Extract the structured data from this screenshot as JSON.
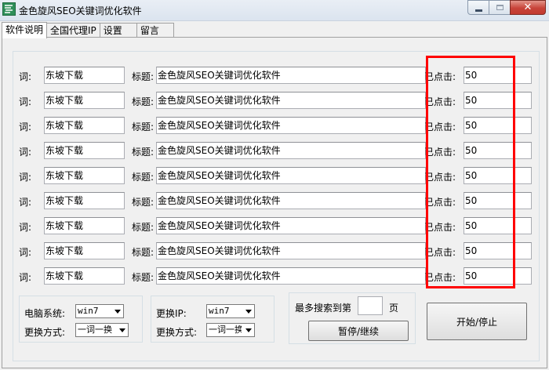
{
  "window": {
    "title": "金色旋风SEO关键词优化软件"
  },
  "tabs": [
    {
      "label": "软件说明"
    },
    {
      "label": "全国代理IP"
    },
    {
      "label": "设置"
    },
    {
      "label": "留言"
    }
  ],
  "rows": [
    {
      "word_label": "词:",
      "word": "东坡下载",
      "title_label": "标题:",
      "title": "金色旋风SEO关键词优化软件",
      "clicked_label": "已点击:",
      "clicked": "50"
    },
    {
      "word_label": "词:",
      "word": "东坡下载",
      "title_label": "标题:",
      "title": "金色旋风SEO关键词优化软件",
      "clicked_label": "已点击:",
      "clicked": "50"
    },
    {
      "word_label": "词:",
      "word": "东坡下载",
      "title_label": "标题:",
      "title": "金色旋风SEO关键词优化软件",
      "clicked_label": "已点击:",
      "clicked": "50"
    },
    {
      "word_label": "词:",
      "word": "东坡下载",
      "title_label": "标题:",
      "title": "金色旋风SEO关键词优化软件",
      "clicked_label": "已点击:",
      "clicked": "50"
    },
    {
      "word_label": "词:",
      "word": "东坡下载",
      "title_label": "标题:",
      "title": "金色旋风SEO关键词优化软件",
      "clicked_label": "已点击:",
      "clicked": "50"
    },
    {
      "word_label": "词:",
      "word": "东坡下载",
      "title_label": "标题:",
      "title": "金色旋风SEO关键词优化软件",
      "clicked_label": "已点击:",
      "clicked": "50"
    },
    {
      "word_label": "词:",
      "word": "东坡下载",
      "title_label": "标题:",
      "title": "金色旋风SEO关键词优化软件",
      "clicked_label": "已点击:",
      "clicked": "50"
    },
    {
      "word_label": "词:",
      "word": "东坡下载",
      "title_label": "标题:",
      "title": "金色旋风SEO关键词优化软件",
      "clicked_label": "已点击:",
      "clicked": "50"
    },
    {
      "word_label": "词:",
      "word": "东坡下载",
      "title_label": "标题:",
      "title": "金色旋风SEO关键词优化软件",
      "clicked_label": "已点击:",
      "clicked": "50"
    }
  ],
  "system_group": {
    "os_label": "电脑系统:",
    "os_value": "win7",
    "switch_label": "更换方式:",
    "switch_value": "一词一换"
  },
  "ip_group": {
    "ip_label": "更换IP:",
    "ip_value": "win7",
    "switch_label": "更换方式:",
    "switch_value": "一词一换"
  },
  "search_group": {
    "max_label": "最多搜索到第",
    "max_value": "",
    "page_suffix": "页",
    "pause_button": "暂停/继续"
  },
  "start_button": "开始/停止",
  "colors": {
    "highlight": "#ff0000"
  }
}
